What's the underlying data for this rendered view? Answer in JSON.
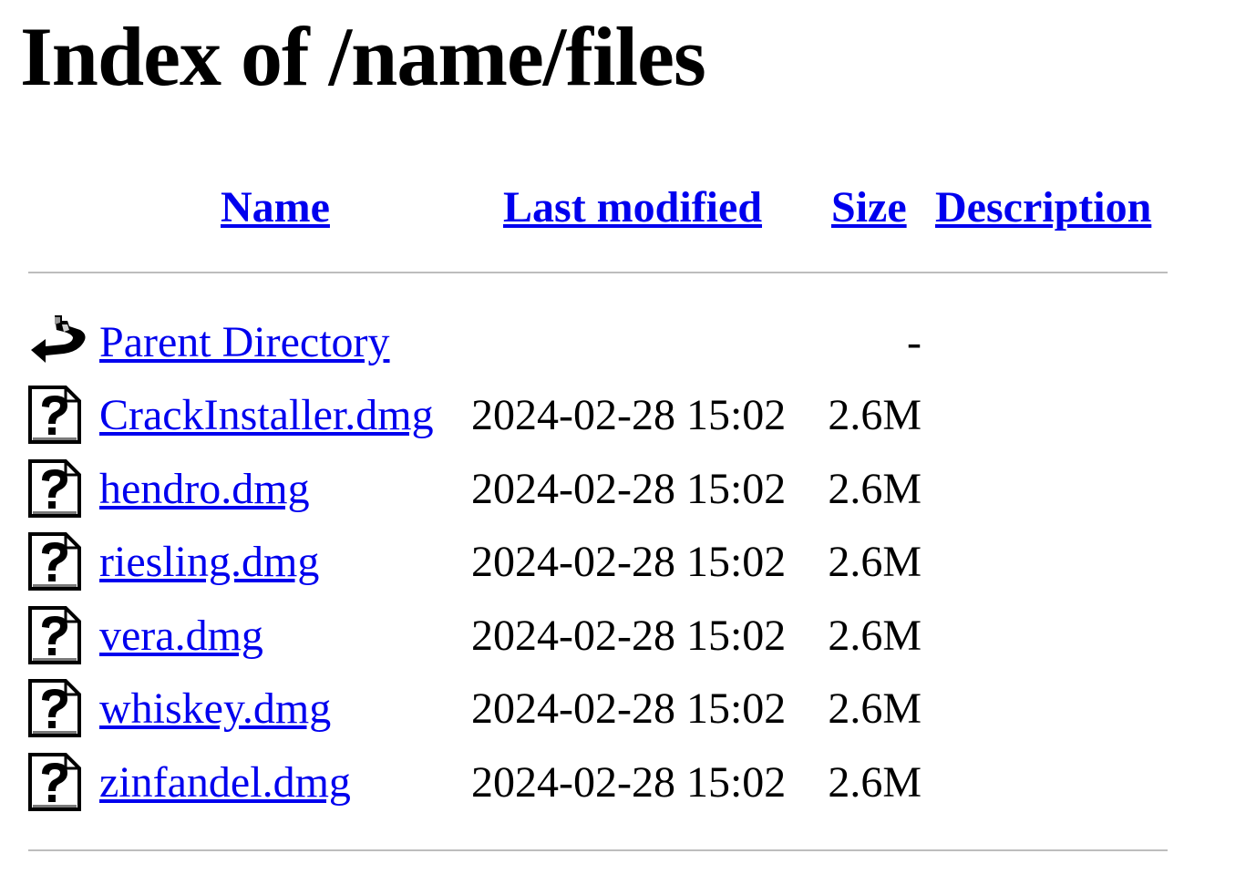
{
  "page": {
    "title": "Index of /name/files"
  },
  "columns": {
    "name": "Name",
    "last_modified": "Last modified",
    "size": "Size",
    "description": "Description"
  },
  "parent": {
    "icon": "back-arrow-icon",
    "label": "Parent Directory",
    "size": "-"
  },
  "files": [
    {
      "name": "CrackInstaller.dmg",
      "modified": "2024-02-28 15:02",
      "size": "2.6M",
      "icon": "unknown-file-icon"
    },
    {
      "name": "hendro.dmg",
      "modified": "2024-02-28 15:02",
      "size": "2.6M",
      "icon": "unknown-file-icon"
    },
    {
      "name": "riesling.dmg",
      "modified": "2024-02-28 15:02",
      "size": "2.6M",
      "icon": "unknown-file-icon"
    },
    {
      "name": "vera.dmg",
      "modified": "2024-02-28 15:02",
      "size": "2.6M",
      "icon": "unknown-file-icon"
    },
    {
      "name": "whiskey.dmg",
      "modified": "2024-02-28 15:02",
      "size": "2.6M",
      "icon": "unknown-file-icon"
    },
    {
      "name": "zinfandel.dmg",
      "modified": "2024-02-28 15:02",
      "size": "2.6M",
      "icon": "unknown-file-icon"
    }
  ],
  "colors": {
    "link": "#0000ee",
    "rule": "#bdbdbd",
    "text": "#000000"
  }
}
